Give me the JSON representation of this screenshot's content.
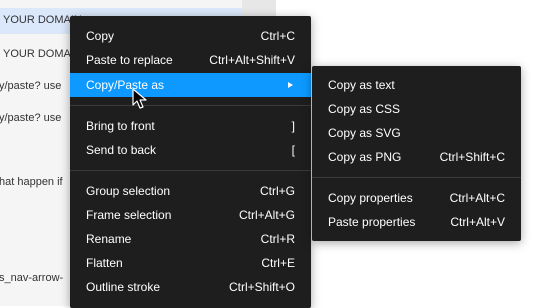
{
  "background": {
    "lines": [
      "YOUR DOMAIN",
      "YOUR DOMAIN",
      "y/paste? use",
      "y/paste? use",
      "hat happen if",
      "s_nav-arrow-"
    ]
  },
  "context_menu": {
    "items": [
      {
        "label": "Copy",
        "shortcut": "Ctrl+C"
      },
      {
        "label": "Paste to replace",
        "shortcut": "Ctrl+Alt+Shift+V"
      },
      {
        "label": "Copy/Paste as",
        "shortcut": ""
      },
      {
        "label": "Bring to front",
        "shortcut": "]"
      },
      {
        "label": "Send to back",
        "shortcut": "["
      },
      {
        "label": "Group selection",
        "shortcut": "Ctrl+G"
      },
      {
        "label": "Frame selection",
        "shortcut": "Ctrl+Alt+G"
      },
      {
        "label": "Rename",
        "shortcut": "Ctrl+R"
      },
      {
        "label": "Flatten",
        "shortcut": "Ctrl+E"
      },
      {
        "label": "Outline stroke",
        "shortcut": "Ctrl+Shift+O"
      }
    ]
  },
  "submenu": {
    "items": [
      {
        "label": "Copy as text",
        "shortcut": ""
      },
      {
        "label": "Copy as CSS",
        "shortcut": ""
      },
      {
        "label": "Copy as SVG",
        "shortcut": ""
      },
      {
        "label": "Copy as PNG",
        "shortcut": "Ctrl+Shift+C"
      },
      {
        "label": "Copy properties",
        "shortcut": "Ctrl+Alt+C"
      },
      {
        "label": "Paste properties",
        "shortcut": "Ctrl+Alt+V"
      }
    ]
  },
  "colors": {
    "menu_bg": "#1e1e1e",
    "active_item": "#0d99ff",
    "text": "#ffffff"
  }
}
